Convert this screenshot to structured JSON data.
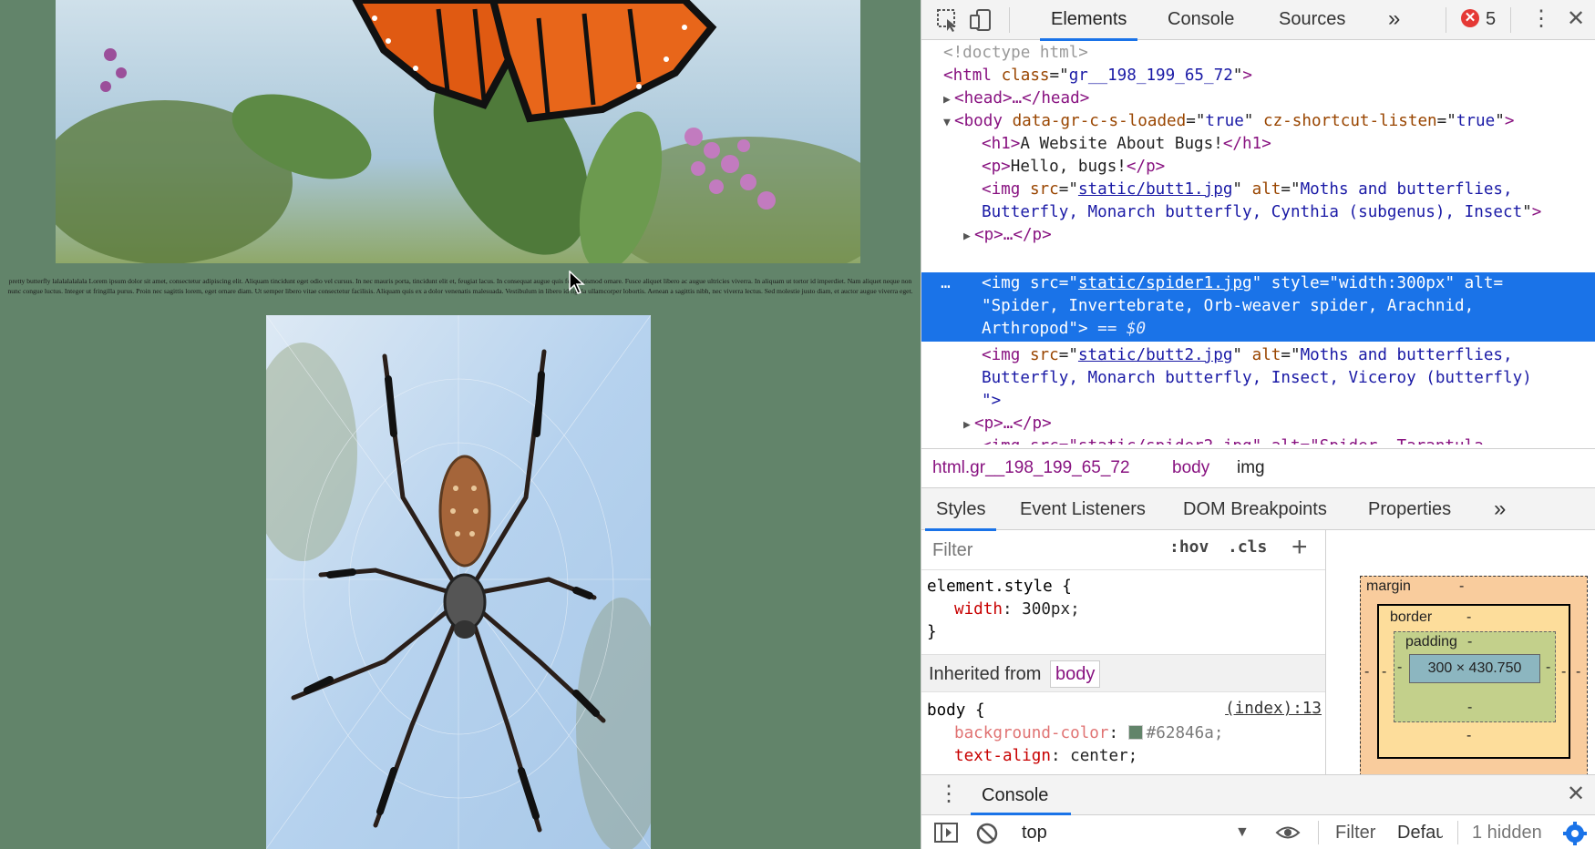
{
  "page": {
    "lorem": "pretty butterfly lalalalalalala Lorem ipsum dolor sit amet, consectetur adipiscing elit. Aliquam tincidunt eget odio vel cursus. In nec mauris porta, tincidunt elit et, feugiat lacus. In consequat augue quis felis euismod ornare. Fusce aliquet libero ac augue ultricies viverra. In aliquam ut tortor id imperdiet. Nam aliquet neque non nunc congue luctus. Integer ut fringilla purus. Proin nec sagittis lorem, eget ornare diam. Ut semper libero vitae consectetur facilisis. Aliquam quis ex a dolor venenatis malesuada. Vestibulum in libero id ligula ullamcorper lobortis. Aenean a sagittis nibh, nec viverra lectus. Sed molestie justo diam, et auctor augue viverra eget.",
    "background": "#62846a"
  },
  "devtools": {
    "tabs": [
      "Elements",
      "Console",
      "Sources"
    ],
    "more": "»",
    "error_count": "5",
    "dom": {
      "doctype": "<!doctype html>",
      "html_open": "<html",
      "html_class_attr": "class",
      "html_class_val": "gr__198_199_65_72",
      "head": "<head>…</head>",
      "body_tag": "<body",
      "body_attr1": "data-gr-c-s-loaded",
      "body_val1": "true",
      "body_attr2": "cz-shortcut-listen",
      "body_val2": "true",
      "h1_open": "<h1>",
      "h1_text": "A Website About Bugs!",
      "h1_close": "</h1>",
      "p_open": "<p>",
      "p_text": "Hello, bugs!",
      "p_close": "</p>",
      "img1_src": "static/butt1.jpg",
      "img1_alt_1": "Moths and butterflies,",
      "img1_alt_2": "Butterfly, Monarch butterfly, Cynthia (subgenus), Insect",
      "p_collapsed": "<p>…</p>",
      "img2_src": "static/spider1.jpg",
      "img2_style": "width:300px",
      "img2_alt_1": "\"Spider, Invertebrate, Orb-weaver spider, Arachnid,",
      "img2_alt_2": "Arthropod\"",
      "eq_sign": "== $0",
      "img3_src": "static/butt2.jpg",
      "img3_alt_1": "Moths and butterflies,",
      "img3_alt_2": "Butterfly, Monarch butterfly, Insect, Viceroy (butterfly)",
      "img3_alt_3": "\">",
      "img4_partial": "<img src=\"static/spider2.jpg\" alt=\"Spider, Tarantula"
    },
    "breadcrumbs": [
      "html.gr__198_199_65_72",
      "body",
      "img"
    ],
    "style_tabs": [
      "Styles",
      "Event Listeners",
      "DOM Breakpoints",
      "Properties"
    ],
    "filter_placeholder": "Filter",
    "hov": ":hov",
    "cls": ".cls",
    "plus": "+",
    "element_style": {
      "selector": "element.style {",
      "prop": "width",
      "value": "300px;",
      "close": "}"
    },
    "inherited_label": "Inherited from",
    "inherited_tag": "body",
    "body_rule": {
      "selector": "body {",
      "source": "(index):13",
      "prop1": "background-color",
      "val1": "#62846a;",
      "prop2": "text-align",
      "val2": "center;"
    },
    "box_model": {
      "margin": "margin",
      "border": "border",
      "padding": "padding",
      "dash": "-",
      "content": "300 × 430.750"
    },
    "drawer": {
      "title": "Console",
      "context": "top",
      "filter": "Filter",
      "levels": "Defau",
      "hidden": "1 hidden"
    }
  }
}
